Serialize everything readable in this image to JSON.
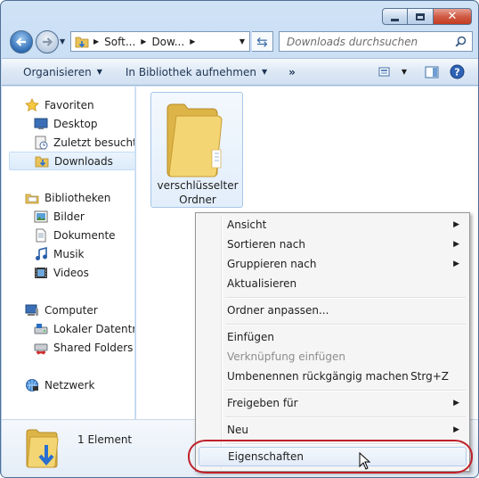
{
  "address": {
    "crumbs": [
      "Soft...",
      "Dow..."
    ]
  },
  "search": {
    "placeholder": "Downloads durchsuchen"
  },
  "toolbar": {
    "organize_label": "Organisieren",
    "library_label": "In Bibliothek aufnehmen",
    "more_label": "»"
  },
  "nav": {
    "favorites": {
      "label": "Favoriten",
      "items": [
        "Desktop",
        "Zuletzt besucht",
        "Downloads"
      ]
    },
    "libraries": {
      "label": "Bibliotheken",
      "items": [
        "Bilder",
        "Dokumente",
        "Musik",
        "Videos"
      ]
    },
    "computer": {
      "label": "Computer",
      "items": [
        "Lokaler Datenträger",
        "Shared Folders (\\\\"
      ]
    },
    "network": {
      "label": "Netzwerk"
    }
  },
  "content": {
    "folder_label_line1": "verschlüsselter",
    "folder_label_line2": "Ordner"
  },
  "details": {
    "count": "1 Element"
  },
  "context_menu": {
    "view": "Ansicht",
    "sort": "Sortieren nach",
    "group": "Gruppieren nach",
    "refresh": "Aktualisieren",
    "customize": "Ordner anpassen...",
    "paste": "Einfügen",
    "paste_shortcut": "Verknüpfung einfügen",
    "undo_rename": "Umbenennen rückgängig machen",
    "undo_shortcut": "Strg+Z",
    "share": "Freigeben für",
    "new": "Neu",
    "properties": "Eigenschaften"
  },
  "icons": {
    "back": "back-arrow-icon",
    "forward": "forward-arrow-icon",
    "refresh": "refresh-icon",
    "search": "search-icon",
    "folder": "folder-icon",
    "star": "star-icon",
    "help": "help-icon"
  },
  "colors": {
    "accent": "#3f6ea6",
    "highlight_oval": "#c0202a",
    "folder": "#e8c35a"
  }
}
